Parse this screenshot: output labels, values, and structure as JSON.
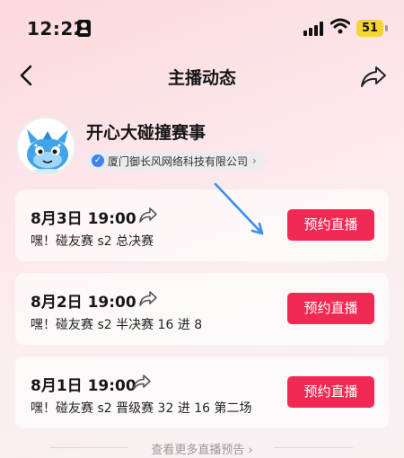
{
  "status": {
    "time": "12:22",
    "battery": "51"
  },
  "nav": {
    "title": "主播动态"
  },
  "profile": {
    "name": "开心大碰撞赛事",
    "company": "厦门御长风网络科技有限公司"
  },
  "events": [
    {
      "time": "8月3日 19:00",
      "desc": "嘿！碰友赛 s2 总决赛",
      "button": "预约直播"
    },
    {
      "time": "8月2日 19:00",
      "desc": "嘿！碰友赛 s2 半决赛 16 进 8",
      "button": "预约直播"
    },
    {
      "time": "8月1日 19:00",
      "desc": "嘿！碰友赛 s2 晋级赛 32 进 16 第二场",
      "button": "预约直播"
    }
  ],
  "more": {
    "label": "查看更多直播预告 ›"
  },
  "colors": {
    "accent": "#f22a53",
    "verify": "#3b82f6",
    "annotation": "#3b8ff0"
  }
}
